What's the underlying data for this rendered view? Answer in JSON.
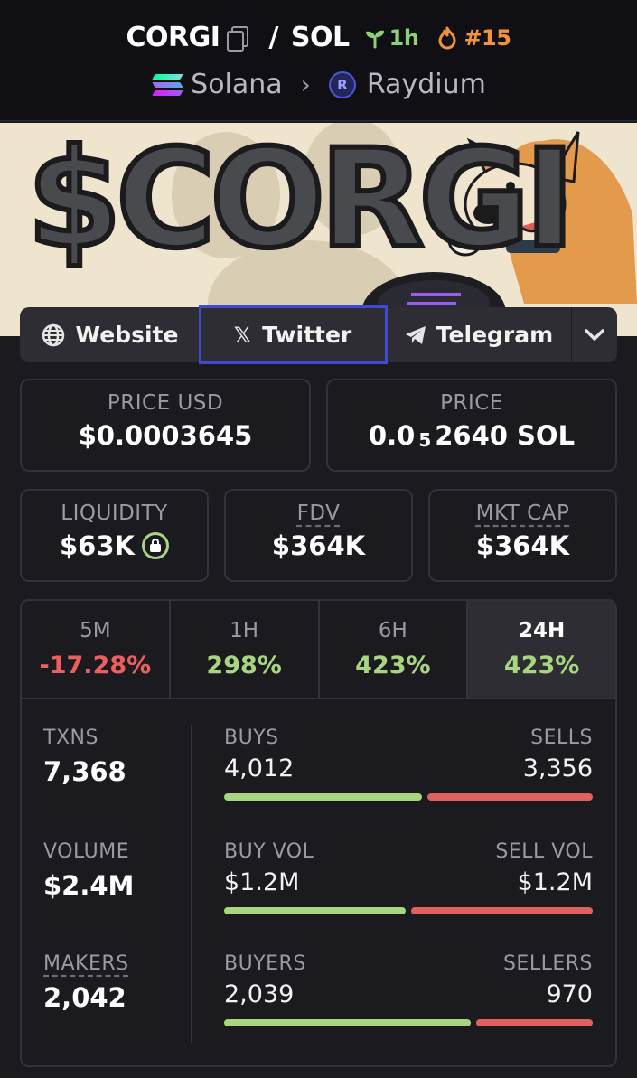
{
  "header": {
    "base_token": "CORGI",
    "separator": "/",
    "quote_token": "SOL",
    "age_label": "1h",
    "rank_label": "#15",
    "chain": "Solana",
    "dex": "Raydium",
    "dex_logo_letter": "R",
    "colors": {
      "age": "#8ed076",
      "rank": "#f4923a"
    }
  },
  "banner": {
    "title": "$CORGI"
  },
  "links": {
    "website": "Website",
    "twitter": "Twitter",
    "telegram": "Telegram"
  },
  "price": {
    "usd_label": "PRICE USD",
    "usd_value": "$0.0003645",
    "native_label": "PRICE",
    "native_prefix": "0.0",
    "native_subscript": "5",
    "native_value": "2640 SOL"
  },
  "metrics": {
    "liquidity_label": "LIQUIDITY",
    "liquidity_value": "$63K",
    "fdv_label": "FDV",
    "fdv_value": "$364K",
    "mcap_label": "MKT CAP",
    "mcap_value": "$364K"
  },
  "timeframes": [
    {
      "label": "5M",
      "change": "-17.28%",
      "direction": "down"
    },
    {
      "label": "1H",
      "change": "298%",
      "direction": "up"
    },
    {
      "label": "6H",
      "change": "423%",
      "direction": "up"
    },
    {
      "label": "24H",
      "change": "423%",
      "direction": "up",
      "active": true
    }
  ],
  "stats": {
    "txns_label": "TXNS",
    "txns_value": "7,368",
    "volume_label": "VOLUME",
    "volume_value": "$2.4M",
    "makers_label": "MAKERS",
    "makers_value": "2,042",
    "buys_label": "BUYS",
    "buys_value": "4,012",
    "sells_label": "SELLS",
    "sells_value": "3,356",
    "buys_share": 0.544,
    "buy_vol_label": "BUY VOL",
    "buy_vol_value": "$1.2M",
    "sell_vol_label": "SELL VOL",
    "sell_vol_value": "$1.2M",
    "buy_vol_share": 0.5,
    "buyers_label": "BUYERS",
    "buyers_value": "2,039",
    "sellers_label": "SELLERS",
    "sellers_value": "970",
    "buyers_share": 0.678
  }
}
